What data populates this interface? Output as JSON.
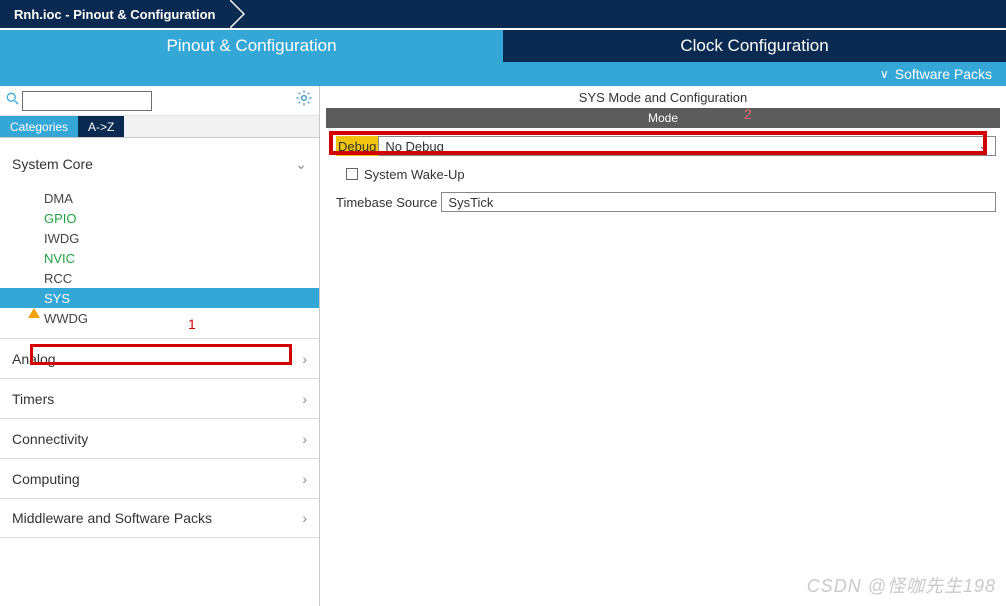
{
  "breadcrumb": {
    "title": "Rnh.ioc - Pinout & Configuration"
  },
  "tabs": {
    "pinout_label": "Pinout & Configuration",
    "clock_label": "Clock Configuration"
  },
  "packs_row": {
    "label": "Software Packs"
  },
  "left": {
    "search_value": "",
    "cat_tab_label": "Categories",
    "az_tab_label": "A->Z",
    "groups": {
      "system_core": "System Core",
      "analog": "Analog",
      "timers": "Timers",
      "connectivity": "Connectivity",
      "computing": "Computing",
      "middleware": "Middleware and Software Packs"
    },
    "items": {
      "dma": "DMA",
      "gpio": "GPIO",
      "iwdg": "IWDG",
      "nvic": "NVIC",
      "rcc": "RCC",
      "sys": "SYS",
      "wwdg": "WWDG"
    }
  },
  "right": {
    "title": "SYS Mode and Configuration",
    "mode_bar": "Mode",
    "debug_label": "Debug",
    "debug_value": "No Debug",
    "wakeup_label": "System Wake-Up",
    "timebase_label": "Timebase Source",
    "timebase_value": "SysTick"
  },
  "annotations": {
    "one": "1",
    "two": "2"
  },
  "watermark": "CSDN @怪咖先生198"
}
